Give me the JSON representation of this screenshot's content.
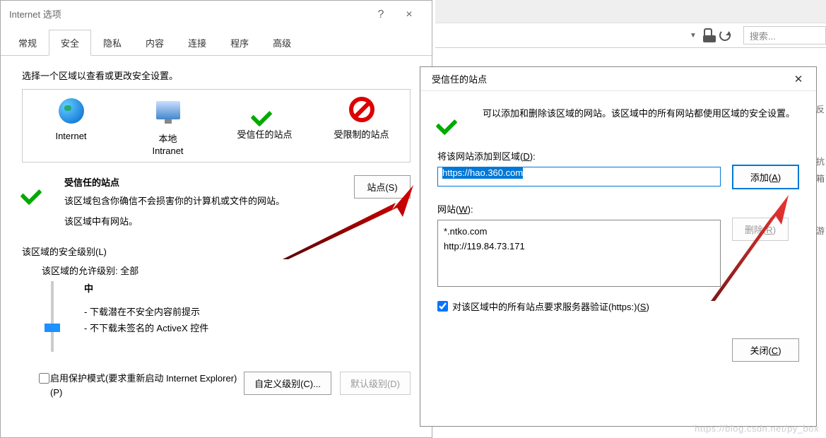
{
  "dlg1": {
    "title": "Internet 选项",
    "help": "?",
    "close": "×",
    "tabs": [
      "常规",
      "安全",
      "隐私",
      "内容",
      "连接",
      "程序",
      "高级"
    ],
    "active_tab_index": 1,
    "select_zone_label": "选择一个区域以查看或更改安全设置。",
    "zones": [
      {
        "name": "Internet"
      },
      {
        "name": "本地\nIntranet"
      },
      {
        "name": "受信任的站点"
      },
      {
        "name": "受限制的站点"
      }
    ],
    "trusted": {
      "heading": "受信任的站点",
      "desc1": "该区域包含你确信不会损害你的计算机或文件的网站。",
      "desc2": "该区域中有网站。",
      "sites_button": "站点(S)"
    },
    "security_level_label": "该区域的安全级别(L)",
    "allow_label": "该区域的允许级别: 全部",
    "slider": {
      "level": "中",
      "desc1": "- 下载潜在不安全内容前提示",
      "desc2": "- 不下载未签名的 ActiveX 控件"
    },
    "protect_mode_label": "启用保护模式(要求重新启动 Internet Explorer)(P)",
    "custom_level_btn": "自定义级别(C)...",
    "default_level_btn": "默认级别(D)"
  },
  "dlg2": {
    "title": "受信任的站点",
    "intro": "可以添加和删除该区域的网站。该区域中的所有网站都使用区域的安全设置。",
    "add_label_pre": "将该网站添加到区域(",
    "add_label_u": "D",
    "add_label_post": "):",
    "url_value": "https://hao.360.com",
    "add_btn_pre": "添加(",
    "add_btn_u": "A",
    "add_btn_post": ")",
    "sites_label_pre": "网站(",
    "sites_label_u": "W",
    "sites_label_post": "):",
    "sites_list": [
      "*.ntko.com",
      "http://119.84.73.171"
    ],
    "remove_btn_pre": "删除(",
    "remove_btn_u": "R",
    "remove_btn_post": ")",
    "https_check_pre": "对该区域中的所有站点要求服务器验证(https:)(",
    "https_check_u": "S",
    "https_check_post": ")",
    "close_btn_pre": "关闭(",
    "close_btn_u": "C",
    "close_btn_post": ")"
  },
  "toolbar": {
    "search_placeholder": "搜索..."
  },
  "edge_hints": [
    "反",
    "抗",
    "箱",
    "游"
  ],
  "watermark": "https://blog.csdn.net/py_box"
}
